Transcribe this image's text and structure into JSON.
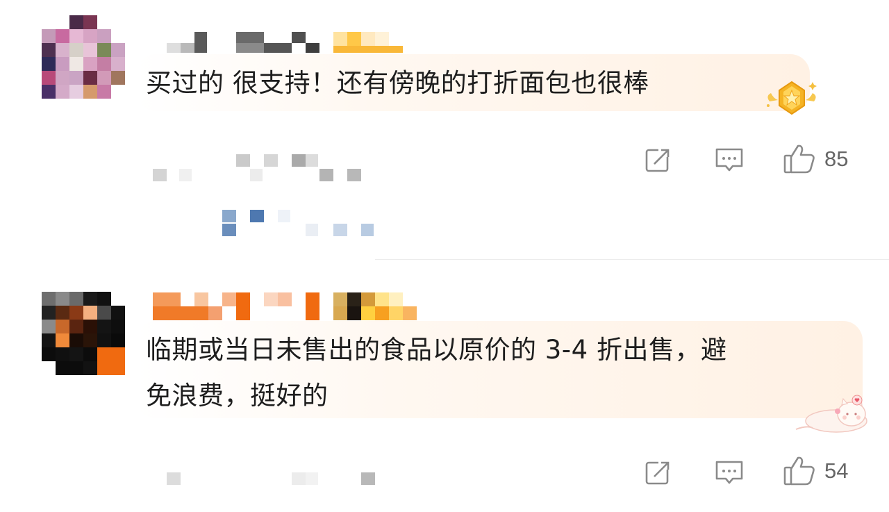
{
  "comments": [
    {
      "text": "买过的 很支持！还有傍晚的打折面包也很棒",
      "likes": "85",
      "badge_icon": "gold-star-medal-icon"
    },
    {
      "text_line1": "临期或当日未售出的食品以原价的 3-4 折出售，避",
      "text_line2": "免浪费，挺好的",
      "likes": "54",
      "badge_icon": "cute-cat-sticker-icon"
    }
  ],
  "icons": {
    "share": "share-icon",
    "reply": "comment-icon",
    "like": "thumbs-up-icon"
  },
  "colors": {
    "bubble_tint": "#fff1e4",
    "icon_gray": "#8a8a8a",
    "count_gray": "#666666",
    "medal_gold": "#f5b324"
  }
}
